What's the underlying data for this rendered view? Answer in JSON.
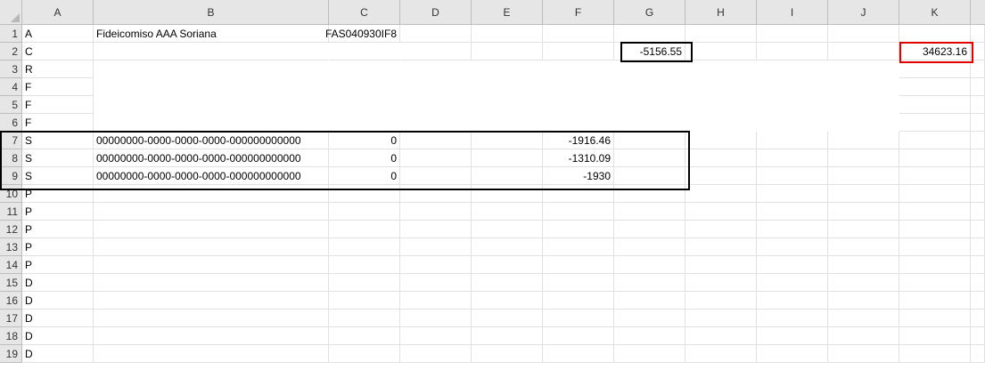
{
  "columns": [
    "A",
    "B",
    "C",
    "D",
    "E",
    "F",
    "G",
    "H",
    "I",
    "J",
    "K"
  ],
  "rows": [
    {
      "num": "1",
      "cells": {
        "A": "A",
        "B": "Fideicomiso AAA Soriana",
        "C": "FAS040930IF8"
      }
    },
    {
      "num": "2",
      "cells": {
        "A": "C",
        "G": "-5156.55",
        "K": "34623.16"
      }
    },
    {
      "num": "3",
      "cells": {
        "A": "R"
      }
    },
    {
      "num": "4",
      "cells": {
        "A": "F"
      }
    },
    {
      "num": "5",
      "cells": {
        "A": "F"
      }
    },
    {
      "num": "6",
      "cells": {
        "A": "F"
      }
    },
    {
      "num": "7",
      "cells": {
        "A": "S",
        "B": "00000000-0000-0000-0000-000000000000",
        "C": "0",
        "F": "-1916.46"
      }
    },
    {
      "num": "8",
      "cells": {
        "A": "S",
        "B": "00000000-0000-0000-0000-000000000000",
        "C": "0",
        "F": "-1310.09"
      }
    },
    {
      "num": "9",
      "cells": {
        "A": "S",
        "B": "00000000-0000-0000-0000-000000000000",
        "C": "0",
        "F": "-1930"
      }
    },
    {
      "num": "10",
      "cells": {
        "A": "P"
      }
    },
    {
      "num": "11",
      "cells": {
        "A": "P"
      }
    },
    {
      "num": "12",
      "cells": {
        "A": "P"
      }
    },
    {
      "num": "13",
      "cells": {
        "A": "P"
      }
    },
    {
      "num": "14",
      "cells": {
        "A": "P"
      }
    },
    {
      "num": "15",
      "cells": {
        "A": "D"
      }
    },
    {
      "num": "16",
      "cells": {
        "A": "D"
      }
    },
    {
      "num": "17",
      "cells": {
        "A": "D"
      }
    },
    {
      "num": "18",
      "cells": {
        "A": "D"
      }
    },
    {
      "num": "19",
      "cells": {
        "A": "D"
      }
    }
  ],
  "numeric_columns": [
    "C",
    "F",
    "G",
    "K"
  ],
  "highlights": {
    "g2_box_color": "#000000",
    "k2_box_color": "#e00000",
    "s_rows_box_color": "#000000"
  }
}
